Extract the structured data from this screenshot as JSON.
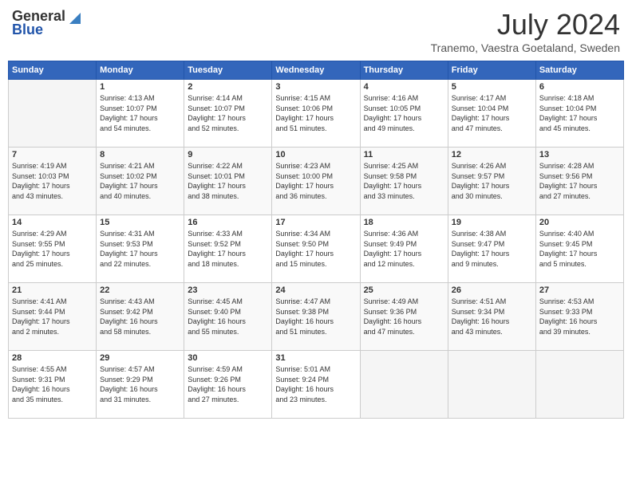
{
  "header": {
    "logo_general": "General",
    "logo_blue": "Blue",
    "month_title": "July 2024",
    "location": "Tranemo, Vaestra Goetaland, Sweden"
  },
  "days_of_week": [
    "Sunday",
    "Monday",
    "Tuesday",
    "Wednesday",
    "Thursday",
    "Friday",
    "Saturday"
  ],
  "weeks": [
    [
      {
        "day": "",
        "info": ""
      },
      {
        "day": "1",
        "info": "Sunrise: 4:13 AM\nSunset: 10:07 PM\nDaylight: 17 hours\nand 54 minutes."
      },
      {
        "day": "2",
        "info": "Sunrise: 4:14 AM\nSunset: 10:07 PM\nDaylight: 17 hours\nand 52 minutes."
      },
      {
        "day": "3",
        "info": "Sunrise: 4:15 AM\nSunset: 10:06 PM\nDaylight: 17 hours\nand 51 minutes."
      },
      {
        "day": "4",
        "info": "Sunrise: 4:16 AM\nSunset: 10:05 PM\nDaylight: 17 hours\nand 49 minutes."
      },
      {
        "day": "5",
        "info": "Sunrise: 4:17 AM\nSunset: 10:04 PM\nDaylight: 17 hours\nand 47 minutes."
      },
      {
        "day": "6",
        "info": "Sunrise: 4:18 AM\nSunset: 10:04 PM\nDaylight: 17 hours\nand 45 minutes."
      }
    ],
    [
      {
        "day": "7",
        "info": "Sunrise: 4:19 AM\nSunset: 10:03 PM\nDaylight: 17 hours\nand 43 minutes."
      },
      {
        "day": "8",
        "info": "Sunrise: 4:21 AM\nSunset: 10:02 PM\nDaylight: 17 hours\nand 40 minutes."
      },
      {
        "day": "9",
        "info": "Sunrise: 4:22 AM\nSunset: 10:01 PM\nDaylight: 17 hours\nand 38 minutes."
      },
      {
        "day": "10",
        "info": "Sunrise: 4:23 AM\nSunset: 10:00 PM\nDaylight: 17 hours\nand 36 minutes."
      },
      {
        "day": "11",
        "info": "Sunrise: 4:25 AM\nSunset: 9:58 PM\nDaylight: 17 hours\nand 33 minutes."
      },
      {
        "day": "12",
        "info": "Sunrise: 4:26 AM\nSunset: 9:57 PM\nDaylight: 17 hours\nand 30 minutes."
      },
      {
        "day": "13",
        "info": "Sunrise: 4:28 AM\nSunset: 9:56 PM\nDaylight: 17 hours\nand 27 minutes."
      }
    ],
    [
      {
        "day": "14",
        "info": "Sunrise: 4:29 AM\nSunset: 9:55 PM\nDaylight: 17 hours\nand 25 minutes."
      },
      {
        "day": "15",
        "info": "Sunrise: 4:31 AM\nSunset: 9:53 PM\nDaylight: 17 hours\nand 22 minutes."
      },
      {
        "day": "16",
        "info": "Sunrise: 4:33 AM\nSunset: 9:52 PM\nDaylight: 17 hours\nand 18 minutes."
      },
      {
        "day": "17",
        "info": "Sunrise: 4:34 AM\nSunset: 9:50 PM\nDaylight: 17 hours\nand 15 minutes."
      },
      {
        "day": "18",
        "info": "Sunrise: 4:36 AM\nSunset: 9:49 PM\nDaylight: 17 hours\nand 12 minutes."
      },
      {
        "day": "19",
        "info": "Sunrise: 4:38 AM\nSunset: 9:47 PM\nDaylight: 17 hours\nand 9 minutes."
      },
      {
        "day": "20",
        "info": "Sunrise: 4:40 AM\nSunset: 9:45 PM\nDaylight: 17 hours\nand 5 minutes."
      }
    ],
    [
      {
        "day": "21",
        "info": "Sunrise: 4:41 AM\nSunset: 9:44 PM\nDaylight: 17 hours\nand 2 minutes."
      },
      {
        "day": "22",
        "info": "Sunrise: 4:43 AM\nSunset: 9:42 PM\nDaylight: 16 hours\nand 58 minutes."
      },
      {
        "day": "23",
        "info": "Sunrise: 4:45 AM\nSunset: 9:40 PM\nDaylight: 16 hours\nand 55 minutes."
      },
      {
        "day": "24",
        "info": "Sunrise: 4:47 AM\nSunset: 9:38 PM\nDaylight: 16 hours\nand 51 minutes."
      },
      {
        "day": "25",
        "info": "Sunrise: 4:49 AM\nSunset: 9:36 PM\nDaylight: 16 hours\nand 47 minutes."
      },
      {
        "day": "26",
        "info": "Sunrise: 4:51 AM\nSunset: 9:34 PM\nDaylight: 16 hours\nand 43 minutes."
      },
      {
        "day": "27",
        "info": "Sunrise: 4:53 AM\nSunset: 9:33 PM\nDaylight: 16 hours\nand 39 minutes."
      }
    ],
    [
      {
        "day": "28",
        "info": "Sunrise: 4:55 AM\nSunset: 9:31 PM\nDaylight: 16 hours\nand 35 minutes."
      },
      {
        "day": "29",
        "info": "Sunrise: 4:57 AM\nSunset: 9:29 PM\nDaylight: 16 hours\nand 31 minutes."
      },
      {
        "day": "30",
        "info": "Sunrise: 4:59 AM\nSunset: 9:26 PM\nDaylight: 16 hours\nand 27 minutes."
      },
      {
        "day": "31",
        "info": "Sunrise: 5:01 AM\nSunset: 9:24 PM\nDaylight: 16 hours\nand 23 minutes."
      },
      {
        "day": "",
        "info": ""
      },
      {
        "day": "",
        "info": ""
      },
      {
        "day": "",
        "info": ""
      }
    ]
  ]
}
